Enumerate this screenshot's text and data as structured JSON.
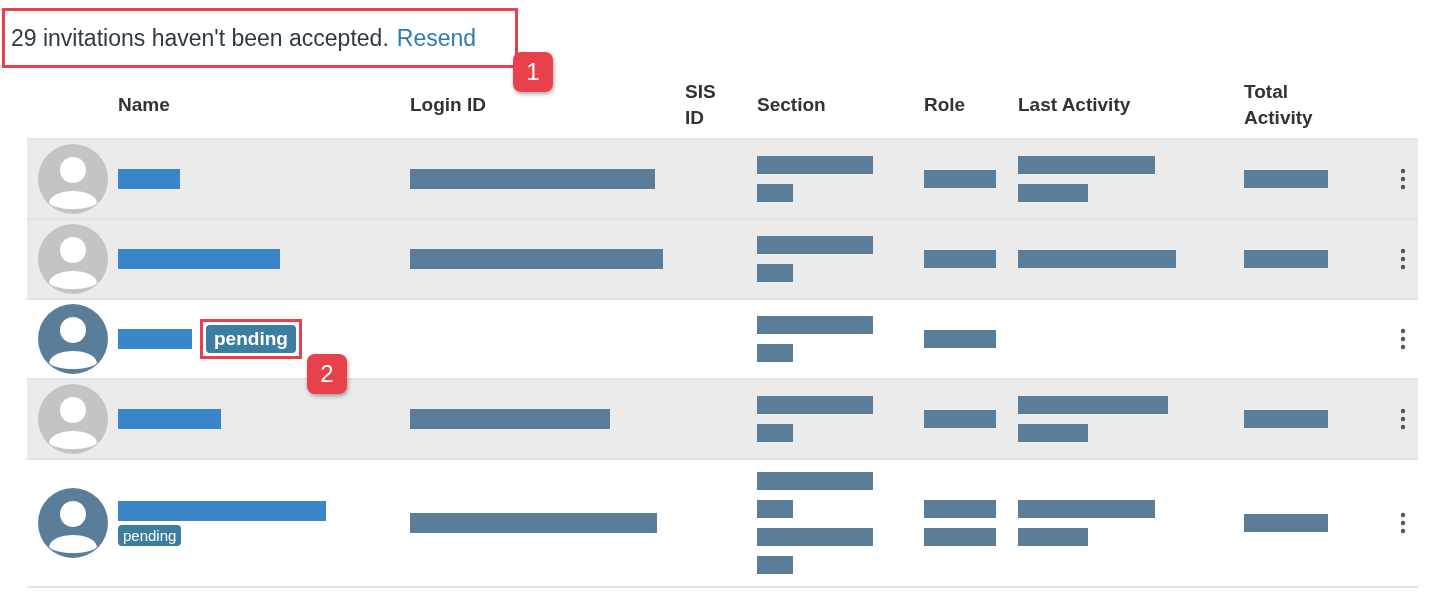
{
  "notice": {
    "text": "29 invitations haven't been accepted.",
    "link": "Resend",
    "callout": "1"
  },
  "table": {
    "columns": [
      "Name",
      "Login ID",
      "SIS ID",
      "Section",
      "Role",
      "Last Activity",
      "Total Activity"
    ],
    "rows": [
      {
        "shaded": true,
        "pending": false,
        "has_login": true,
        "has_last_activity": true,
        "has_total_activity": true
      },
      {
        "shaded": true,
        "pending": false,
        "has_login": true,
        "has_last_activity": true,
        "has_total_activity": true
      },
      {
        "shaded": false,
        "pending": true,
        "badge": {
          "text": "pending",
          "kind": "large"
        },
        "callout": "2",
        "has_login": false,
        "has_last_activity": false,
        "has_total_activity": false
      },
      {
        "shaded": true,
        "pending": false,
        "has_login": true,
        "has_last_activity": true,
        "has_total_activity": true
      },
      {
        "shaded": false,
        "pending": true,
        "badge": {
          "text": "pending",
          "kind": "small"
        },
        "has_login": true,
        "has_last_activity": true,
        "has_total_activity": true
      }
    ]
  }
}
